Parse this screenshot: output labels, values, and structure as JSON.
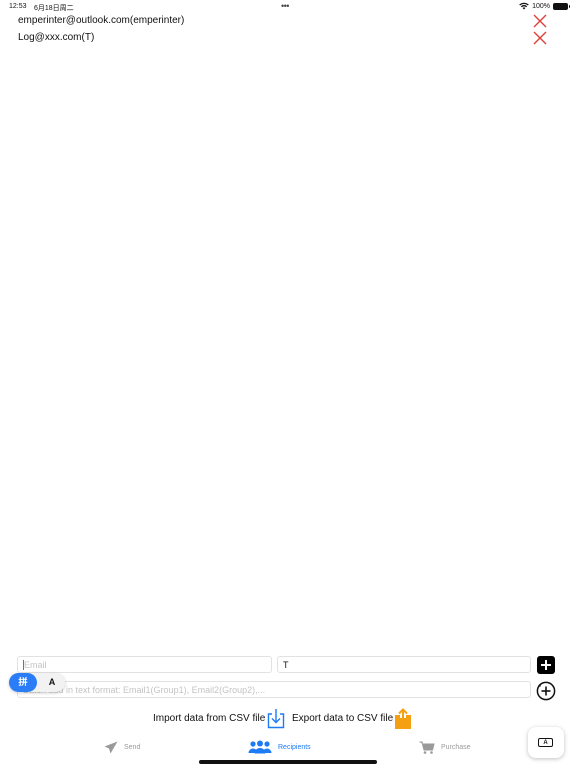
{
  "status_bar": {
    "time": "12:53",
    "date": "6月18日周二",
    "battery": "100%"
  },
  "recipients": [
    {
      "text": "emperinter@outlook.com(emperinter)"
    },
    {
      "text": "Log@xxx.com(T)"
    }
  ],
  "form": {
    "email_placeholder": "Email",
    "email_value": "",
    "group_value": "T",
    "batch_placeholder": "Batch add in text format: Email1(Group1), Email2(Group2),..."
  },
  "ime": {
    "active_label": "拼",
    "alt_label": "A"
  },
  "csv": {
    "import_label": "Import data from CSV file",
    "export_label": "Export data to CSV file"
  },
  "tabs": [
    {
      "label": "Send",
      "state": "inactive"
    },
    {
      "label": "Recipients",
      "state": "active"
    },
    {
      "label": "Purchase",
      "state": "inactive"
    }
  ],
  "keyboard_button": {
    "label": "A"
  },
  "colors": {
    "accent": "#1d7bf5",
    "delete": "#e0403a",
    "export_icon": "#f5a013",
    "inactive_tab": "#9a9a9a"
  }
}
